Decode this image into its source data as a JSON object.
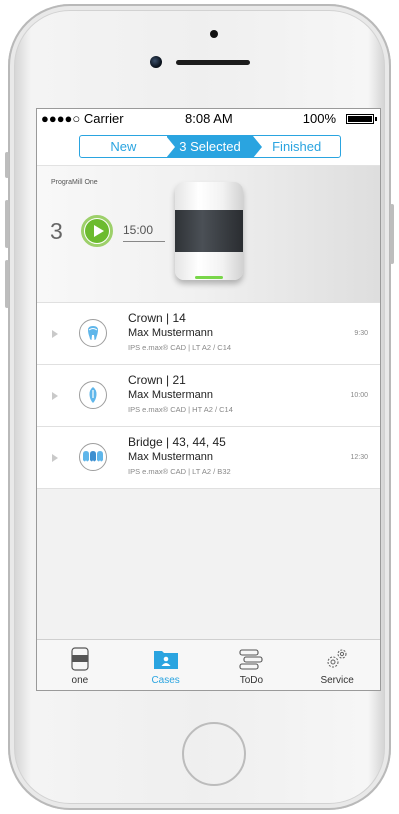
{
  "status_bar": {
    "carrier": "●●●●○ Carrier",
    "time": "8:08 AM",
    "battery": "100%"
  },
  "segments": [
    {
      "label": "New"
    },
    {
      "label": "3 Selected",
      "active": true
    },
    {
      "label": "Finished"
    }
  ],
  "machine": {
    "name": "PrograMill One",
    "queue_count": "3",
    "duration": "15:00"
  },
  "cases": [
    {
      "title": "Crown | 14",
      "patient": "Max Mustermann",
      "material": "IPS e.max® CAD | LT A2 / C14",
      "time": "9:30",
      "icon": "crown-tooth-icon"
    },
    {
      "title": "Crown | 21",
      "patient": "Max Mustermann",
      "material": "IPS e.max® CAD | HT A2 / C14",
      "time": "10:00",
      "icon": "incisor-tooth-icon"
    },
    {
      "title": "Bridge | 43, 44, 45",
      "patient": "Max Mustermann",
      "material": "IPS e.max® CAD | LT A2 / B32",
      "time": "12:30",
      "icon": "bridge-tooth-icon"
    }
  ],
  "tabs": [
    {
      "label": "one",
      "icon": "machine-icon"
    },
    {
      "label": "Cases",
      "icon": "folder-icon",
      "active": true
    },
    {
      "label": "ToDo",
      "icon": "todo-icon"
    },
    {
      "label": "Service",
      "icon": "gears-icon"
    }
  ],
  "colors": {
    "accent": "#2aa4e0",
    "play_green": "#6cbb2f"
  }
}
